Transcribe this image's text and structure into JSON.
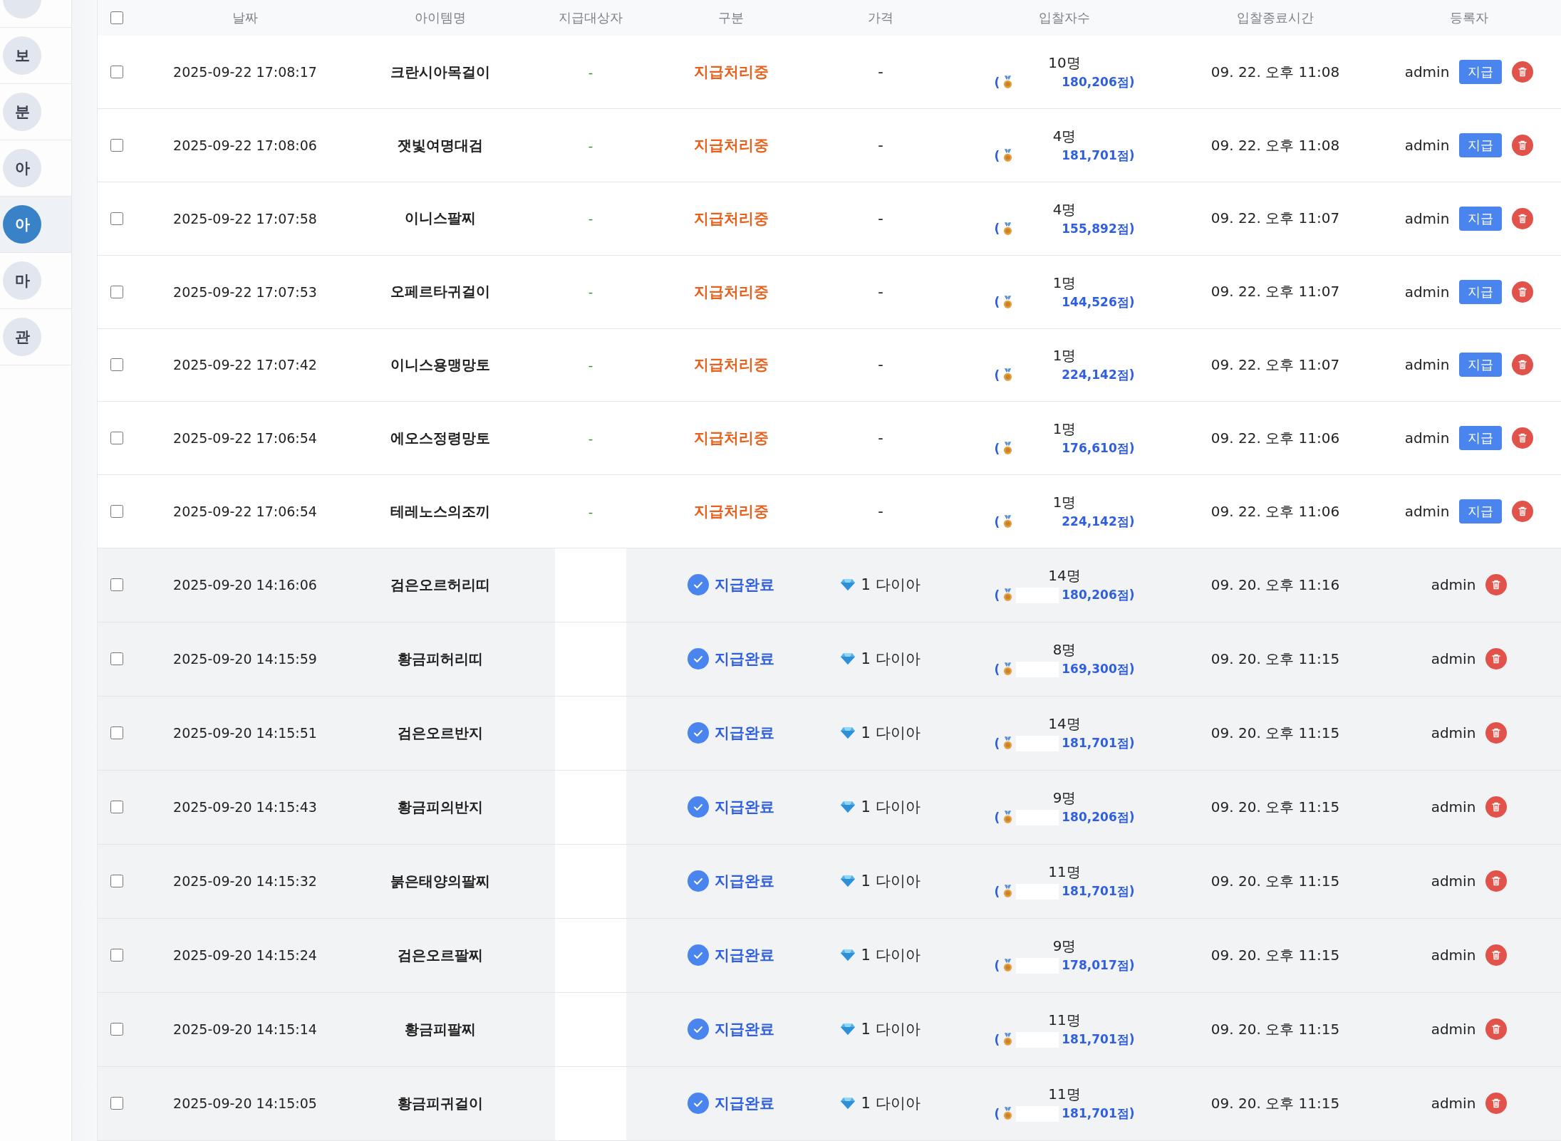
{
  "sidebar": {
    "items": [
      {
        "selected": false
      },
      {
        "label": "보",
        "selected": false
      },
      {
        "label": "분",
        "selected": false
      },
      {
        "label": "아",
        "selected": false
      },
      {
        "label": "아",
        "selected": true
      },
      {
        "label": "마",
        "selected": false
      },
      {
        "label": "관",
        "selected": false
      }
    ]
  },
  "table": {
    "select_all": {
      "checked": false
    },
    "columns": [
      "날짜",
      "아이템명",
      "지급대상자",
      "구분",
      "가격",
      "입찰자수",
      "입찰종료시간",
      "등록자"
    ],
    "rows": [
      {
        "kind": "pending",
        "checked": false,
        "date": "2025-09-22 17:08:17",
        "item": "크란시아목걸이",
        "target": "-",
        "status": "지급처리중",
        "price": "-",
        "bidders": "10명",
        "bid_open": "(",
        "bid_score": "180,206점)",
        "end_time": "09. 22. 오후 11:08",
        "registrant": "admin",
        "pay_button": "지급"
      },
      {
        "kind": "pending",
        "checked": false,
        "date": "2025-09-22 17:08:06",
        "item": "잿빛여명대검",
        "target": "-",
        "status": "지급처리중",
        "price": "-",
        "bidders": "4명",
        "bid_open": "(",
        "bid_score": "181,701점)",
        "end_time": "09. 22. 오후 11:08",
        "registrant": "admin",
        "pay_button": "지급"
      },
      {
        "kind": "pending",
        "checked": false,
        "date": "2025-09-22 17:07:58",
        "item": "이니스팔찌",
        "target": "-",
        "status": "지급처리중",
        "price": "-",
        "bidders": "4명",
        "bid_open": "(",
        "bid_score": "155,892점)",
        "end_time": "09. 22. 오후 11:07",
        "registrant": "admin",
        "pay_button": "지급"
      },
      {
        "kind": "pending",
        "checked": false,
        "date": "2025-09-22 17:07:53",
        "item": "오페르타귀걸이",
        "target": "-",
        "status": "지급처리중",
        "price": "-",
        "bidders": "1명",
        "bid_open": "(",
        "bid_score": "144,526점)",
        "end_time": "09. 22. 오후 11:07",
        "registrant": "admin",
        "pay_button": "지급"
      },
      {
        "kind": "pending",
        "checked": false,
        "date": "2025-09-22 17:07:42",
        "item": "이니스용맹망토",
        "target": "-",
        "status": "지급처리중",
        "price": "-",
        "bidders": "1명",
        "bid_open": "(",
        "bid_score": "224,142점)",
        "end_time": "09. 22. 오후 11:07",
        "registrant": "admin",
        "pay_button": "지급"
      },
      {
        "kind": "pending",
        "checked": false,
        "date": "2025-09-22 17:06:54",
        "item": "에오스정령망토",
        "target": "-",
        "status": "지급처리중",
        "price": "-",
        "bidders": "1명",
        "bid_open": "(",
        "bid_score": "176,610점)",
        "end_time": "09. 22. 오후 11:06",
        "registrant": "admin",
        "pay_button": "지급"
      },
      {
        "kind": "pending",
        "checked": false,
        "date": "2025-09-22 17:06:54",
        "item": "테레노스의조끼",
        "target": "-",
        "status": "지급처리중",
        "price": "-",
        "bidders": "1명",
        "bid_open": "(",
        "bid_score": "224,142점)",
        "end_time": "09. 22. 오후 11:06",
        "registrant": "admin",
        "pay_button": "지급"
      },
      {
        "kind": "done",
        "checked": false,
        "date": "2025-09-20 14:16:06",
        "item": "검은오르허리띠",
        "status": "지급완료",
        "price": "1 다이아",
        "bidders": "14명",
        "bid_open": "(",
        "bid_score": "180,206점)",
        "end_time": "09. 20. 오후 11:16",
        "registrant": "admin"
      },
      {
        "kind": "done",
        "checked": false,
        "date": "2025-09-20 14:15:59",
        "item": "황금피허리띠",
        "status": "지급완료",
        "price": "1 다이아",
        "bidders": "8명",
        "bid_open": "(",
        "bid_score": "169,300점)",
        "end_time": "09. 20. 오후 11:15",
        "registrant": "admin"
      },
      {
        "kind": "done",
        "checked": false,
        "date": "2025-09-20 14:15:51",
        "item": "검은오르반지",
        "status": "지급완료",
        "price": "1 다이아",
        "bidders": "14명",
        "bid_open": "(",
        "bid_score": "181,701점)",
        "end_time": "09. 20. 오후 11:15",
        "registrant": "admin"
      },
      {
        "kind": "done",
        "checked": false,
        "date": "2025-09-20 14:15:43",
        "item": "황금피의반지",
        "status": "지급완료",
        "price": "1 다이아",
        "bidders": "9명",
        "bid_open": "(",
        "bid_score": "180,206점)",
        "end_time": "09. 20. 오후 11:15",
        "registrant": "admin"
      },
      {
        "kind": "done",
        "checked": false,
        "date": "2025-09-20 14:15:32",
        "item": "붉은태양의팔찌",
        "status": "지급완료",
        "price": "1 다이아",
        "bidders": "11명",
        "bid_open": "(",
        "bid_score": "181,701점)",
        "end_time": "09. 20. 오후 11:15",
        "registrant": "admin"
      },
      {
        "kind": "done",
        "checked": false,
        "date": "2025-09-20 14:15:24",
        "item": "검은오르팔찌",
        "status": "지급완료",
        "price": "1 다이아",
        "bidders": "9명",
        "bid_open": "(",
        "bid_score": "178,017점)",
        "end_time": "09. 20. 오후 11:15",
        "registrant": "admin"
      },
      {
        "kind": "done",
        "checked": false,
        "date": "2025-09-20 14:15:14",
        "item": "황금피팔찌",
        "status": "지급완료",
        "price": "1 다이아",
        "bidders": "11명",
        "bid_open": "(",
        "bid_score": "181,701점)",
        "end_time": "09. 20. 오후 11:15",
        "registrant": "admin"
      },
      {
        "kind": "done",
        "checked": false,
        "date": "2025-09-20 14:15:05",
        "item": "황금피귀걸이",
        "status": "지급완료",
        "price": "1 다이아",
        "bidders": "11명",
        "bid_open": "(",
        "bid_score": "181,701점)",
        "end_time": "09. 20. 오후 11:15",
        "registrant": "admin"
      }
    ]
  }
}
